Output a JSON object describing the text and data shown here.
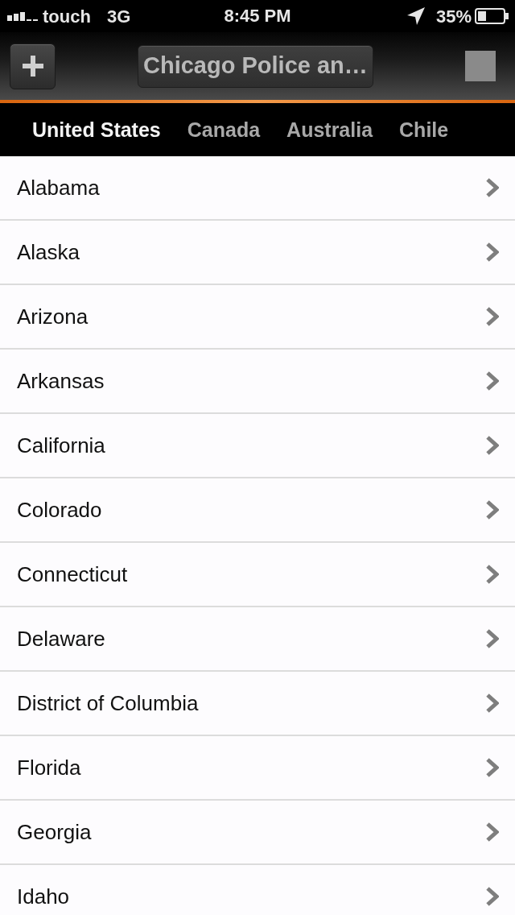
{
  "status_bar": {
    "carrier": "touch",
    "network": "3G",
    "time": "8:45 PM",
    "battery": "35%"
  },
  "nav_bar": {
    "title": "Chicago Police an…"
  },
  "tabs": [
    {
      "label": "United States",
      "selected": true
    },
    {
      "label": "Canada",
      "selected": false
    },
    {
      "label": "Australia",
      "selected": false
    },
    {
      "label": "Chile",
      "selected": false
    }
  ],
  "list": {
    "items": [
      {
        "label": "Alabama"
      },
      {
        "label": "Alaska"
      },
      {
        "label": "Arizona"
      },
      {
        "label": "Arkansas"
      },
      {
        "label": "California"
      },
      {
        "label": "Colorado"
      },
      {
        "label": "Connecticut"
      },
      {
        "label": "Delaware"
      },
      {
        "label": "District of Columbia"
      },
      {
        "label": "Florida"
      },
      {
        "label": "Georgia"
      },
      {
        "label": "Idaho"
      }
    ]
  }
}
